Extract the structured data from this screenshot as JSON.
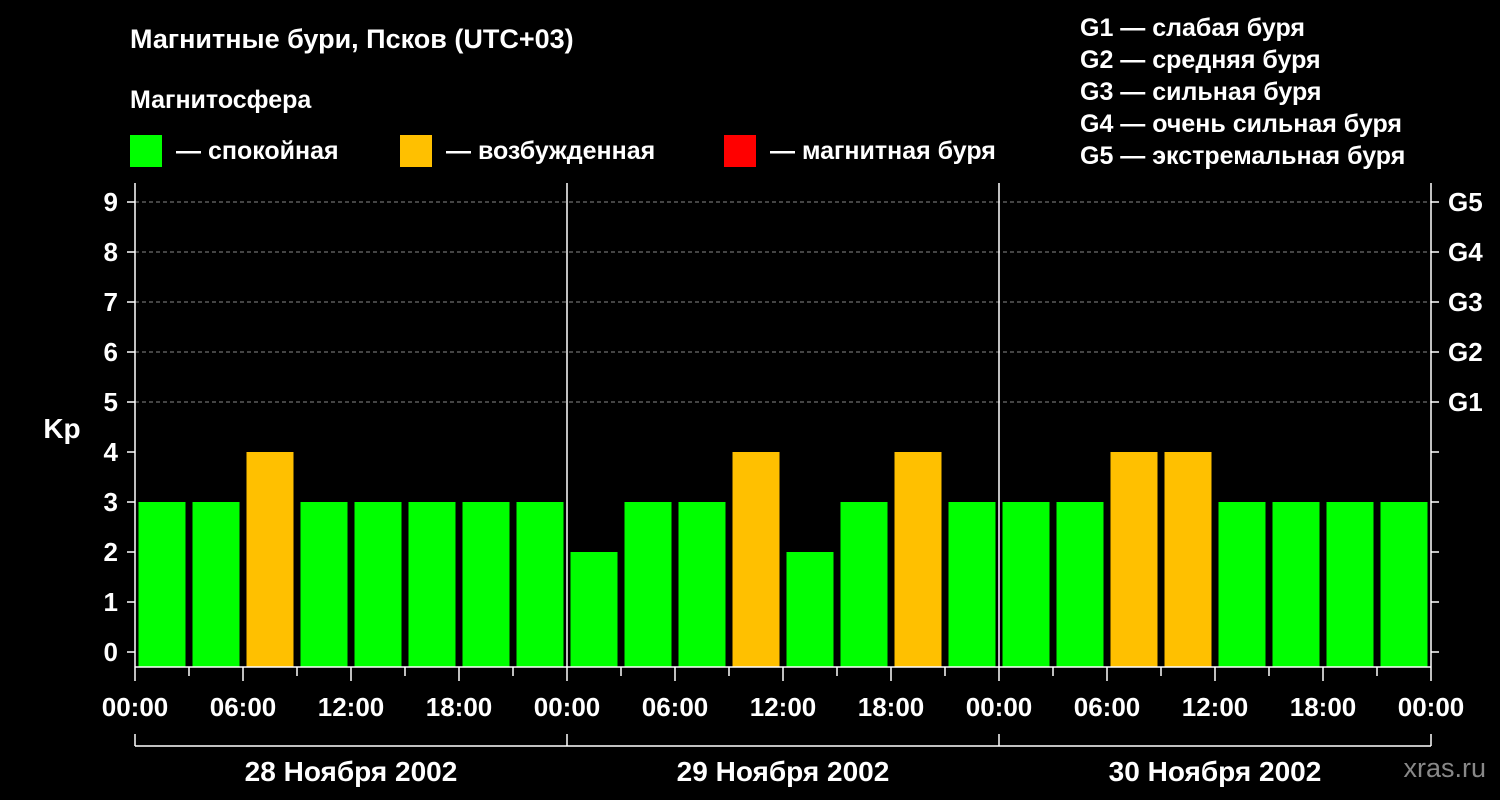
{
  "header": {
    "title": "Магнитные бури, Псков (UTC+03)",
    "subtitle": "Магнитосфера"
  },
  "legend": [
    {
      "label": "— спокойная",
      "color": "#00ff00"
    },
    {
      "label": "— возбужденная",
      "color": "#ffc000"
    },
    {
      "label": "— магнитная буря",
      "color": "#ff0000"
    }
  ],
  "g_legend": [
    "G1 — слабая буря",
    "G2 — средняя буря",
    "G3 — сильная буря",
    "G4 — очень сильная буря",
    "G5 — экстремальная буря"
  ],
  "watermark": "xras.ru",
  "chart_data": {
    "type": "bar",
    "ylabel": "Kp",
    "ylim": [
      0,
      9
    ],
    "y_ticks": [
      0,
      1,
      2,
      3,
      4,
      5,
      6,
      7,
      8,
      9
    ],
    "g_ticks": [
      {
        "kp": 5,
        "label": "G1"
      },
      {
        "kp": 6,
        "label": "G2"
      },
      {
        "kp": 7,
        "label": "G3"
      },
      {
        "kp": 8,
        "label": "G4"
      },
      {
        "kp": 9,
        "label": "G5"
      }
    ],
    "grid": "dashed at Kp 5–9",
    "x_tick_labels": [
      "00:00",
      "06:00",
      "12:00",
      "18:00",
      "00:00",
      "06:00",
      "12:00",
      "18:00",
      "00:00",
      "06:00",
      "12:00",
      "18:00",
      "00:00"
    ],
    "days": [
      "28 Ноября 2002",
      "29 Ноября 2002",
      "30 Ноября 2002"
    ],
    "values": [
      3,
      3,
      4,
      3,
      3,
      3,
      3,
      3,
      2,
      3,
      3,
      4,
      2,
      3,
      4,
      3,
      3,
      3,
      4,
      4,
      3,
      3,
      3,
      3
    ],
    "status": [
      "calm",
      "calm",
      "excited",
      "calm",
      "calm",
      "calm",
      "calm",
      "calm",
      "calm",
      "calm",
      "calm",
      "excited",
      "calm",
      "calm",
      "excited",
      "calm",
      "calm",
      "calm",
      "excited",
      "excited",
      "calm",
      "calm",
      "calm",
      "calm"
    ],
    "colors": {
      "calm": "#00ff00",
      "excited": "#ffc000",
      "storm": "#ff0000"
    }
  }
}
